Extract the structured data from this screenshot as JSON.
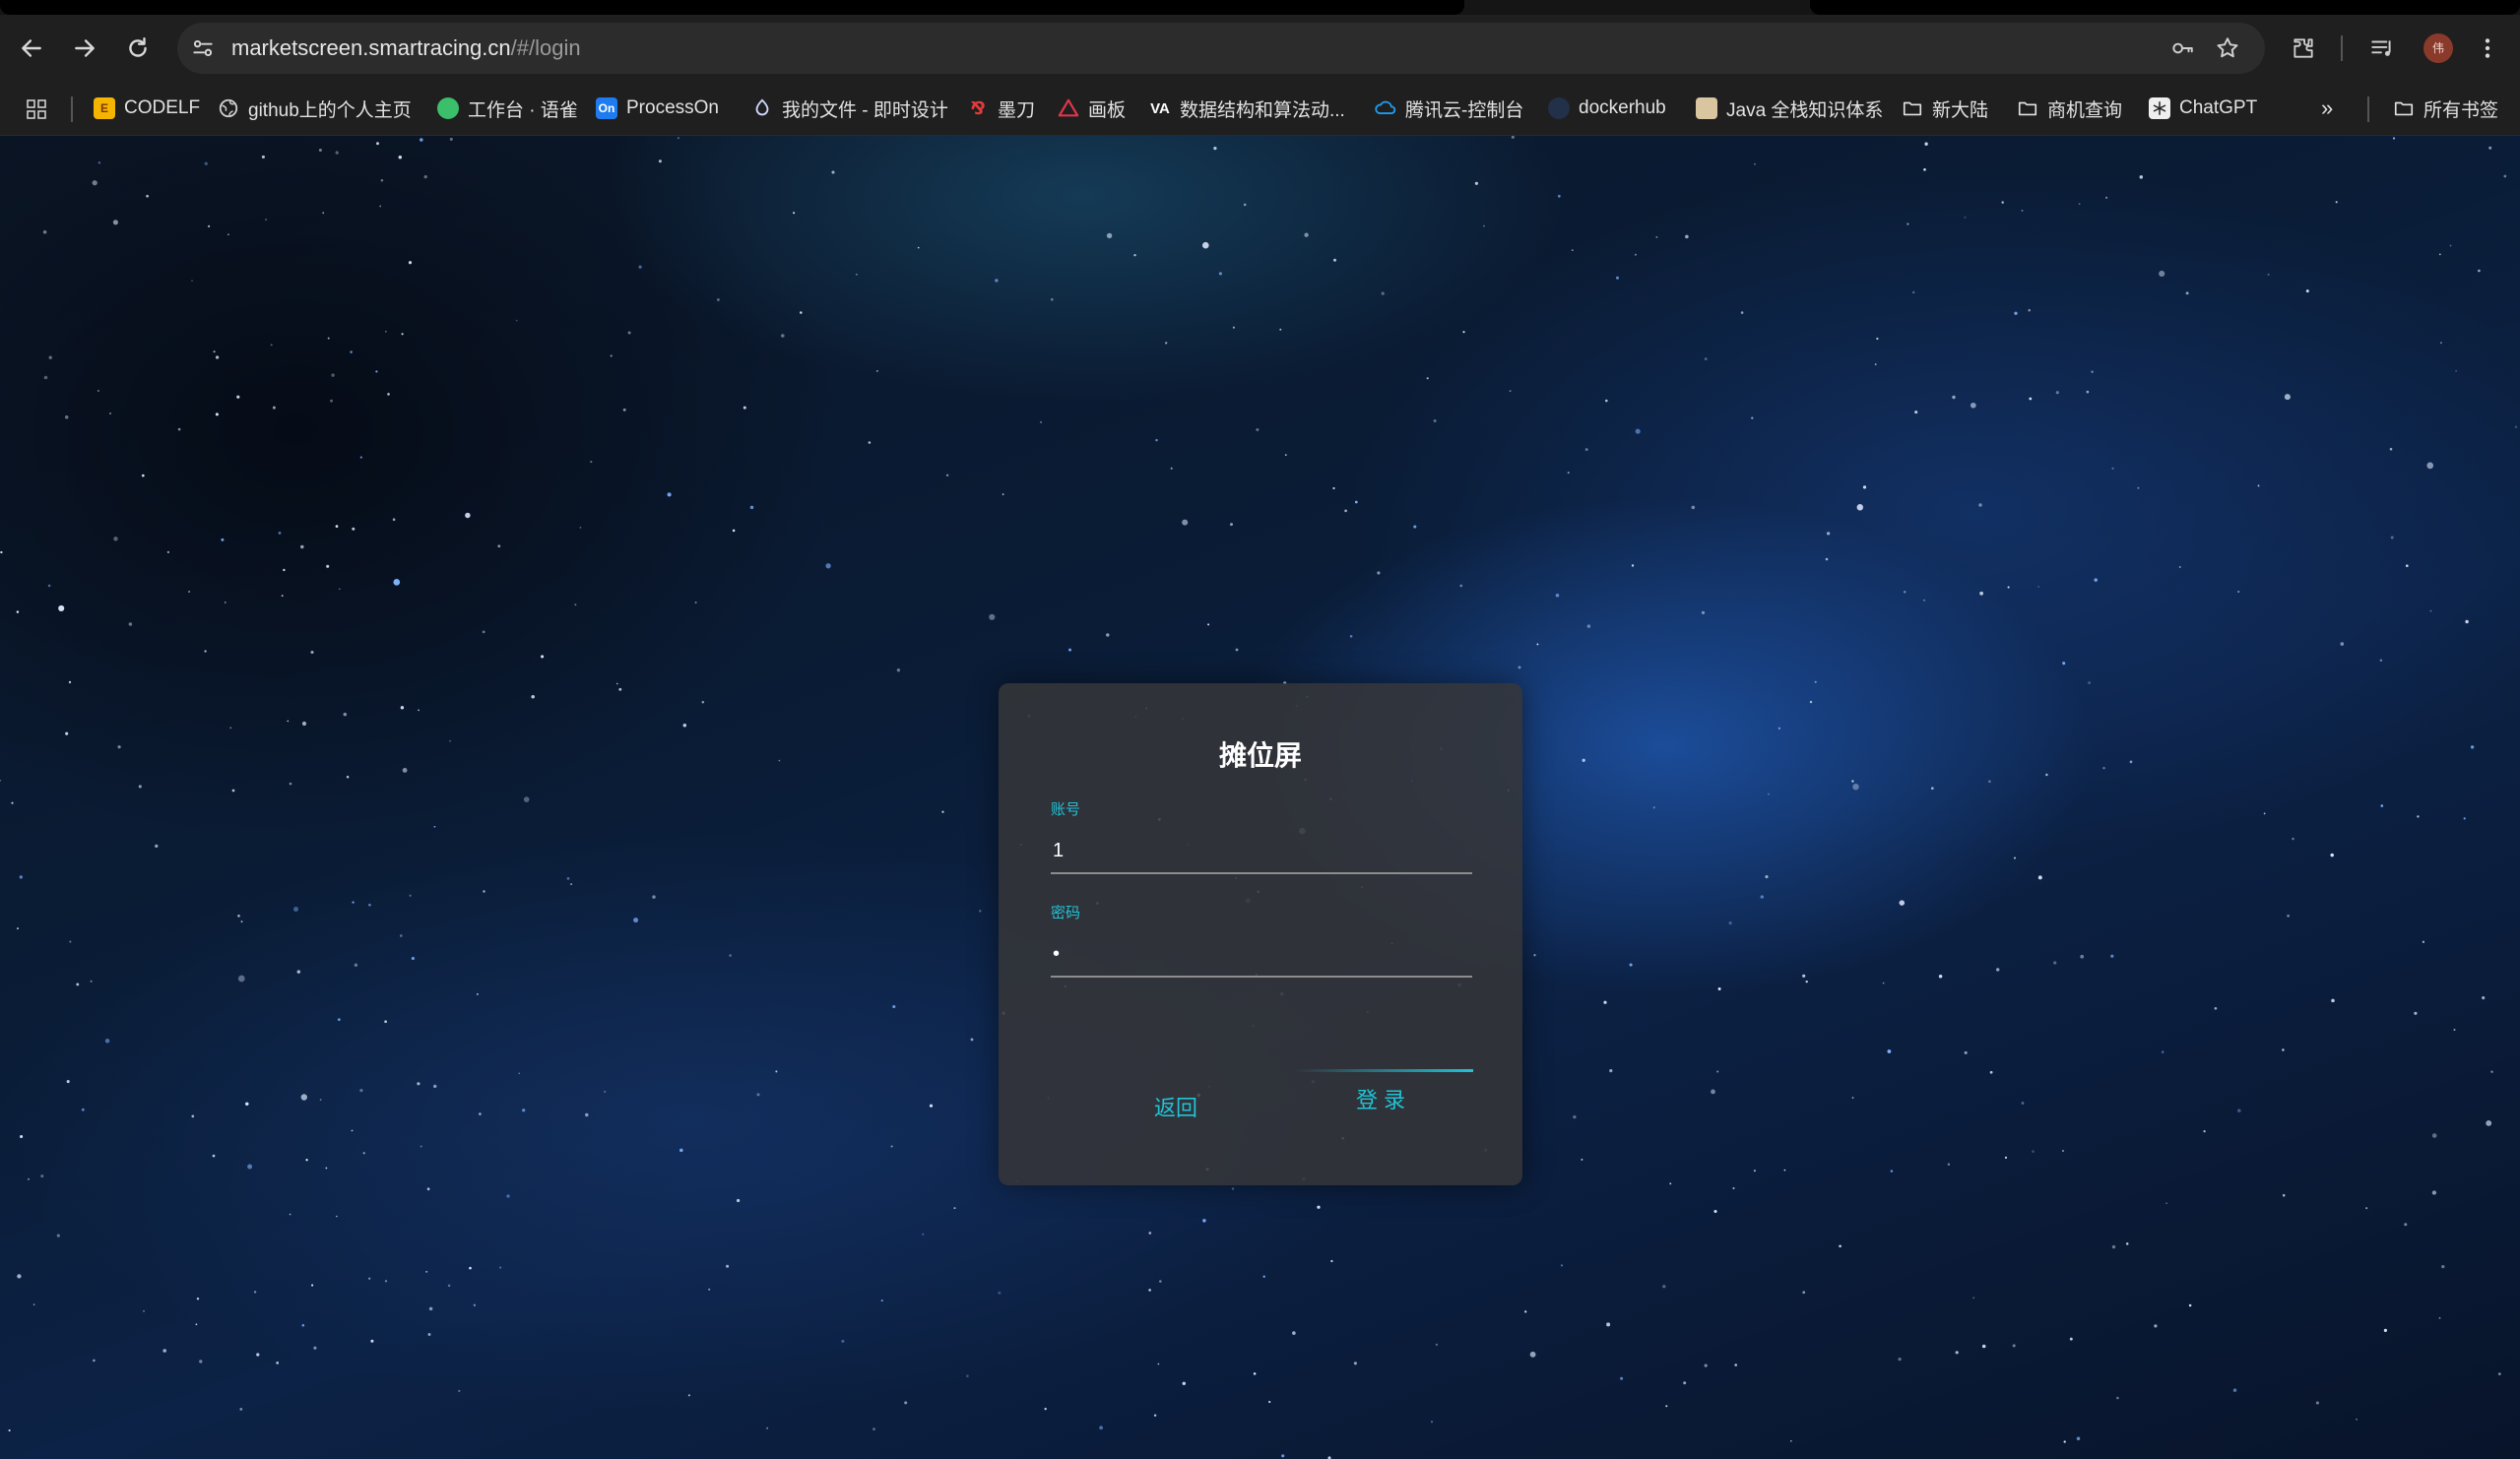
{
  "browser": {
    "url_host": "marketscreen.smartracing.cn",
    "url_path": "/#/login",
    "avatar_initial": "伟",
    "bookmarks": [
      {
        "label": "CODELF",
        "icon": "codelf-icon",
        "color": "#f5b400"
      },
      {
        "label": "github上的个人主页",
        "icon": "globe-icon",
        "color": "#cfcfcf"
      },
      {
        "label": "工作台 · 语雀",
        "icon": "yuque-icon",
        "color": "#3cbf6a"
      },
      {
        "label": "ProcessOn",
        "icon": "processon-icon",
        "color": "#1e7bf0"
      },
      {
        "label": "我的文件 - 即时设计",
        "icon": "jishi-icon",
        "color": "#cfd8ff"
      },
      {
        "label": "墨刀",
        "icon": "modao-icon",
        "color": "#e23b3b"
      },
      {
        "label": "画板",
        "icon": "huaban-icon",
        "color": "#e2354a"
      },
      {
        "label": "数据结构和算法动...",
        "icon": "visualgo-icon",
        "color": "#ffffff"
      },
      {
        "label": "腾讯云-控制台",
        "icon": "tencent-cloud-icon",
        "color": "#1f9cf0"
      },
      {
        "label": "dockerhub",
        "icon": "docker-icon",
        "color": "#2d5e9e"
      },
      {
        "label": "Java 全栈知识体系",
        "icon": "java-icon",
        "color": "#e0b070"
      },
      {
        "label": "新大陆",
        "icon": "folder-icon",
        "color": "#e2e2e2"
      },
      {
        "label": "商机查询",
        "icon": "folder-icon",
        "color": "#e2e2e2"
      },
      {
        "label": "ChatGPT",
        "icon": "chatgpt-icon",
        "color": "#e8e8e8"
      }
    ],
    "all_bookmarks_label": "所有书签"
  },
  "login": {
    "title": "摊位屏",
    "account_label": "账号",
    "account_value": "1",
    "password_label": "密码",
    "password_value": "•",
    "back_label": "返回",
    "login_label": "登录",
    "accent_color": "#21c3d6"
  }
}
